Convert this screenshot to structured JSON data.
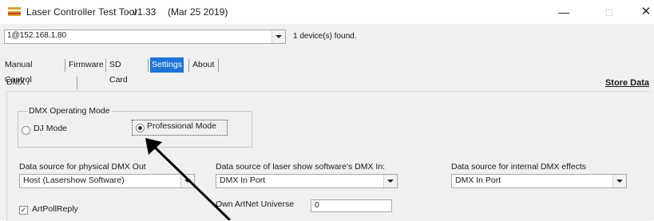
{
  "window": {
    "title": "Laser Controller Test Tool",
    "version": "v1.33",
    "date": "(Mar 25 2019)",
    "minimize_glyph": "—",
    "maximize_glyph": "□",
    "close_glyph": "✕"
  },
  "device": {
    "selected": "1@152.168.1.80",
    "status": "1 device(s) found."
  },
  "tabs": [
    {
      "label": "Manual Control"
    },
    {
      "label": "Firmware"
    },
    {
      "label": "SD Card"
    },
    {
      "label": "Settings",
      "active": true
    },
    {
      "label": "About"
    }
  ],
  "subtabs": [
    {
      "label": "DMX / ArtNet"
    }
  ],
  "store_data_label": "Store Data",
  "dmx_mode": {
    "legend": "DMX Operating Mode",
    "options": [
      {
        "label": "DJ Mode",
        "checked": false
      },
      {
        "label": "Professional Mode",
        "checked": true
      }
    ]
  },
  "sources": {
    "physical": {
      "label": "Data source for physical DMX Out",
      "value": "Host (Lasershow Software)"
    },
    "lasershow": {
      "label": "Data source of laser show software's DMX In:",
      "value": "DMX In Port"
    },
    "internal": {
      "label": "Data source for internal DMX effects",
      "value": "DMX In Port"
    }
  },
  "art_poll_reply": {
    "label": "ArtPollReply",
    "checked": true
  },
  "artnet_universe": {
    "label": "Own ArtNet Universe",
    "value": "0"
  },
  "colors": {
    "active_tab": "#1e74d8",
    "background": "#f0f0f0",
    "annotation_arrow": "#000000"
  },
  "icons": [
    "app-icon",
    "combo-arrow-icon",
    "annotation-arrow"
  ]
}
